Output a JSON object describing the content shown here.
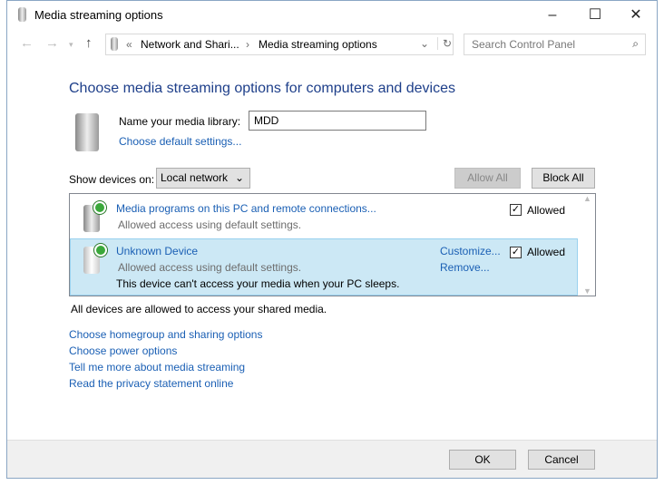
{
  "window": {
    "title": "Media streaming options",
    "minimize": "–",
    "maximize": "☐",
    "close": "✕"
  },
  "address": {
    "prefix": "«",
    "crumbs": [
      "Network and Shari...",
      "Media streaming options"
    ],
    "separator": "›"
  },
  "search": {
    "placeholder": "Search Control Panel"
  },
  "heading": "Choose media streaming options for computers and devices",
  "library": {
    "label": "Name your media library:",
    "value": "MDD",
    "default_link": "Choose default settings..."
  },
  "show_devices": {
    "label": "Show devices on:",
    "selected": "Local network"
  },
  "buttons": {
    "allow_all": "Allow All",
    "block_all": "Block All",
    "ok": "OK",
    "cancel": "Cancel"
  },
  "devices": [
    {
      "name": "Media programs on this PC and remote connections...",
      "status": "Allowed access using default settings.",
      "allowed_label": "Allowed",
      "checked": true
    },
    {
      "name": "Unknown Device",
      "status": "Allowed access using default settings.",
      "note": "This device can't access your media when your PC sleeps.",
      "customize": "Customize...",
      "remove": "Remove...",
      "allowed_label": "Allowed",
      "checked": true,
      "selected": true
    }
  ],
  "summary": "All devices are allowed to access your shared media.",
  "links": [
    "Choose homegroup and sharing options",
    "Choose power options",
    "Tell me more about media streaming",
    "Read the privacy statement online"
  ]
}
